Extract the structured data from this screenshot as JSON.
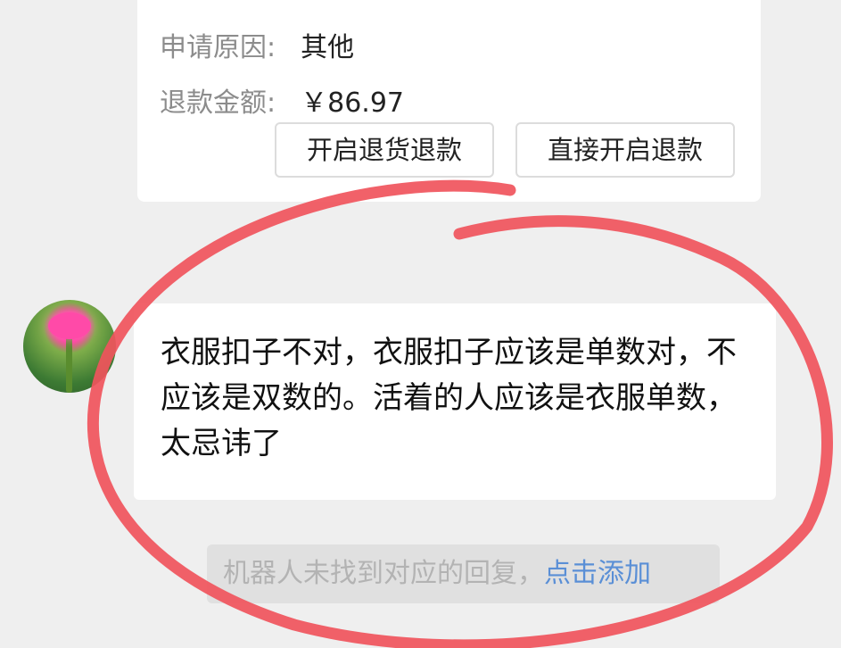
{
  "refund_card": {
    "reason_label": "申请原因:",
    "reason_value": "其他",
    "amount_label": "退款金额:",
    "amount_value": "￥86.97",
    "btn_return_refund": "开启退货退款",
    "btn_direct_refund": "直接开启退款"
  },
  "chat": {
    "message": "衣服扣子不对，衣服扣子应该是单数对，不应该是双数的。活着的人应该是衣服单数，太忌讳了"
  },
  "bot_notice": {
    "text": "机器人未找到对应的回复，",
    "link": "点击添加"
  },
  "colors": {
    "background": "#efefef",
    "link": "#5a8fd6",
    "annotation_circle": "#f0545c"
  }
}
